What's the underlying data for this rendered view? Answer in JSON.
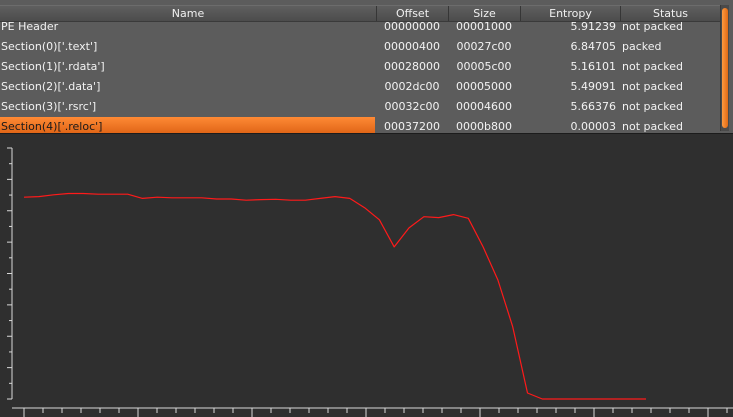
{
  "table": {
    "headers": {
      "name": "Name",
      "offset": "Offset",
      "size": "Size",
      "entropy": "Entropy",
      "status": "Status"
    },
    "rows": [
      {
        "name": "PE Header",
        "offset": "00000000",
        "size": "00001000",
        "entropy": "5.91239",
        "status": "not packed",
        "selected": false
      },
      {
        "name": "Section(0)['.text']",
        "offset": "00000400",
        "size": "00027c00",
        "entropy": "6.84705",
        "status": "packed",
        "selected": false
      },
      {
        "name": "Section(1)['.rdata']",
        "offset": "00028000",
        "size": "00005c00",
        "entropy": "5.16101",
        "status": "not packed",
        "selected": false
      },
      {
        "name": "Section(2)['.data']",
        "offset": "0002dc00",
        "size": "00005000",
        "entropy": "5.49091",
        "status": "not packed",
        "selected": false
      },
      {
        "name": "Section(3)['.rsrc']",
        "offset": "00032c00",
        "size": "00004600",
        "entropy": "5.66376",
        "status": "not packed",
        "selected": false
      },
      {
        "name": "Section(4)['.reloc']",
        "offset": "00037200",
        "size": "0000b800",
        "entropy": "0.00003",
        "status": "not packed",
        "selected": true
      }
    ]
  },
  "colors": {
    "selection": "#f07a20",
    "line": "#ff1a1a",
    "panel": "#5c5c5c",
    "background": "#2f2f2f"
  },
  "chart_data": {
    "type": "line",
    "title": "",
    "xlabel": "",
    "ylabel": "",
    "ylim": [
      0,
      8
    ],
    "grid": false,
    "series": [
      {
        "values": [
          6.7,
          6.72,
          6.78,
          6.82,
          6.82,
          6.8,
          6.8,
          6.8,
          6.66,
          6.7,
          6.68,
          6.68,
          6.68,
          6.64,
          6.64,
          6.6,
          6.62,
          6.63,
          6.6,
          6.6,
          6.66,
          6.72,
          6.66,
          6.35,
          5.95,
          5.05,
          5.68,
          6.05,
          6.02,
          6.12,
          6.0,
          5.05,
          3.95,
          2.4,
          0.2,
          0.0,
          0.0,
          0.0,
          0.0,
          0.0,
          0.0,
          0.0,
          0.0
        ]
      }
    ]
  }
}
